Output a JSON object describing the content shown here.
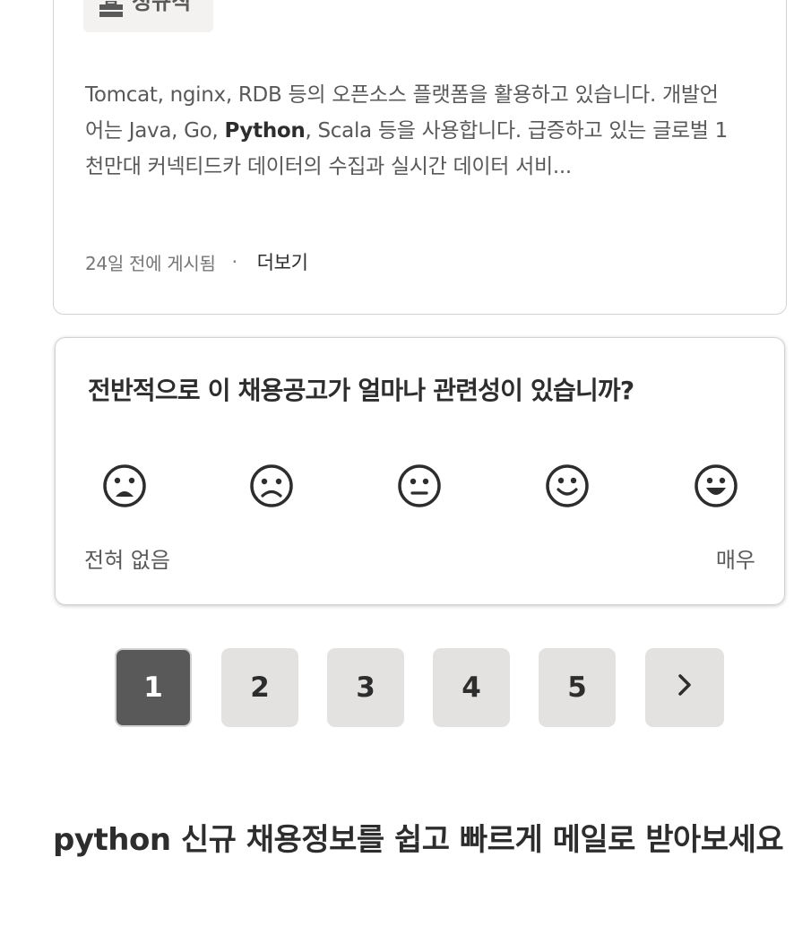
{
  "job": {
    "type_badge": "정규직",
    "snippet_before": "Tomcat, nginx, RDB 등의 오픈소스 플랫폼을 활용하고 있습니다. 개발언어는 Java, Go, ",
    "snippet_bold": "Python",
    "snippet_after": ", Scala 등을 사용합니다. 급증하고 있는 글로벌 1천만대 커넥티드카 데이터의 수집과 실시간 데이터 서비...",
    "posted": "24일 전에 게시됨",
    "separator": "·",
    "more_label": "더보기"
  },
  "survey": {
    "question": "전반적으로 이 채용공고가 얼마나 관련성이 있습니까?",
    "faces": [
      "very-sad-face-icon",
      "sad-face-icon",
      "neutral-face-icon",
      "smile-face-icon",
      "grin-face-icon"
    ],
    "low_label": "전혀 없음",
    "high_label": "매우"
  },
  "pagination": {
    "pages": [
      "1",
      "2",
      "3",
      "4",
      "5"
    ],
    "current": "1",
    "next_icon": "chevron-right-icon"
  },
  "alert": {
    "keyword": "python",
    "text": " 신규 채용정보를 쉽고 빠르게 메일로 받아보세요"
  },
  "colors": {
    "active_page": "#595959",
    "page_bg": "#e4e2e0",
    "text_dark": "#2d2d2d",
    "text_muted": "#595959"
  }
}
